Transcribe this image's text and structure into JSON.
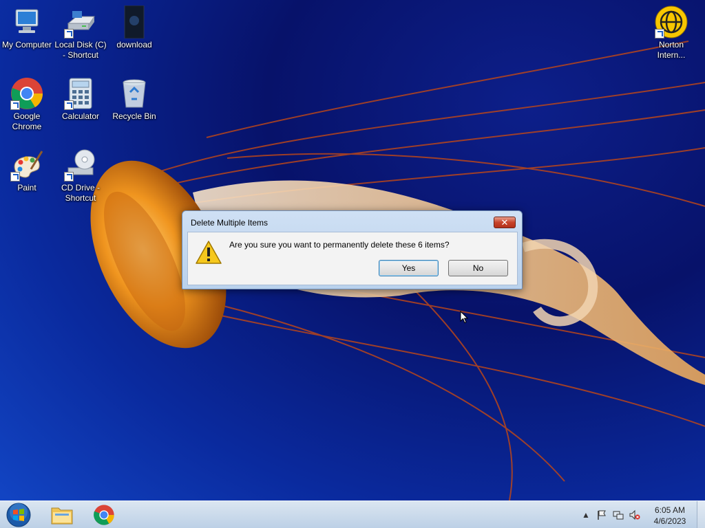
{
  "desktop": {
    "icons": [
      {
        "label": "My Computer",
        "icon": "computer-icon",
        "shortcut": false
      },
      {
        "label": "Local Disk (C) - Shortcut",
        "icon": "drive-icon",
        "shortcut": true
      },
      {
        "label": "download",
        "icon": "image-file-icon",
        "shortcut": false
      },
      {
        "label": "Google Chrome",
        "icon": "chrome-icon",
        "shortcut": true
      },
      {
        "label": "Calculator",
        "icon": "calculator-icon",
        "shortcut": true
      },
      {
        "label": "Recycle Bin",
        "icon": "recycle-bin-icon",
        "shortcut": false
      },
      {
        "label": "Paint",
        "icon": "paint-icon",
        "shortcut": true
      },
      {
        "label": "CD Drive - Shortcut",
        "icon": "cd-drive-icon",
        "shortcut": true
      },
      {
        "label": "Norton Intern...",
        "icon": "norton-globe-icon",
        "shortcut": true
      }
    ]
  },
  "dialog": {
    "title": "Delete Multiple Items",
    "close_label": "✕",
    "message": "Are you sure you want to permanently delete these 6 items?",
    "yes_label": "Yes",
    "no_label": "No",
    "icon": "warning-icon"
  },
  "taskbar": {
    "start_icon": "windows-start-icon",
    "pinned": [
      {
        "name": "file-explorer",
        "icon": "folder-icon"
      },
      {
        "name": "google-chrome",
        "icon": "chrome-icon"
      }
    ],
    "tray": {
      "show_hidden_label": "▲",
      "time": "6:05 AM",
      "date": "4/6/2023"
    }
  },
  "colors": {
    "wallpaper_dark": "#07126a",
    "wallpaper_light": "#1348c8",
    "jellyfish_orange": "#e8891c",
    "dialog_frame": "#b9d1ec",
    "close_red": "#c7432a"
  }
}
